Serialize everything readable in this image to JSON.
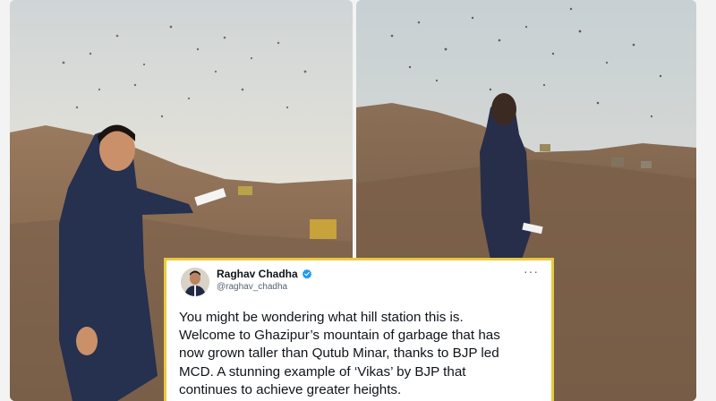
{
  "tweet": {
    "author_name": "Raghav Chadha",
    "handle": "@raghav_chadha",
    "text": "You might be wondering what hill station this is.\nWelcome to Ghazipur’s mountain of garbage that has\nnow grown taller than Qutub Minar, thanks to BJP led\nMCD. A stunning example of ‘Vikas’ by BJP that\ncontinues to achieve greater heights.",
    "more_glyph": "···"
  },
  "icons": {
    "verified": "verified-badge-icon",
    "more": "more-options-icon"
  },
  "colors": {
    "tweet_border": "#e9c93a",
    "verified_blue": "#1d9bf0",
    "sky_left": "#dfe3e3",
    "landfill_brown": "#8a6a4f"
  }
}
